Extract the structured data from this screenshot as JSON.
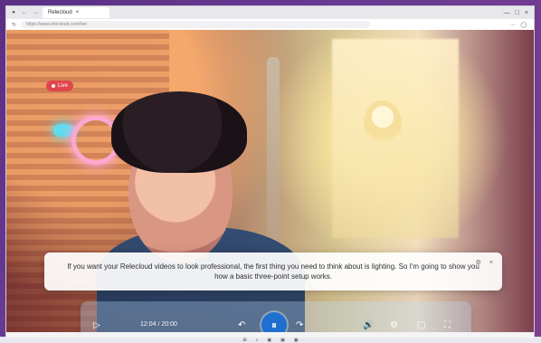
{
  "browser": {
    "tab_title": "Relecloud",
    "url": "https://www.relecloud.com/live",
    "window_controls": {
      "minimize": "—",
      "maximize": "□",
      "close": "×"
    }
  },
  "video": {
    "live_label": "Live",
    "caption": "If you want your Relecloud videos to look professional, the first thing you need to think about is lighting. So I'm going to show you how a basic three-point setup works.",
    "time": "12:04 / 20:00",
    "progress": 0.6
  },
  "icons": {
    "back": "←",
    "forward": "→",
    "refresh": "↻",
    "play": "▷",
    "rewind": "↶",
    "pause": "⏸",
    "forward10": "↷",
    "volume": "🔊",
    "settings": "⚙",
    "cc": "▢",
    "fullscreen": "⛶",
    "caption_settings": "⚙",
    "caption_close": "×"
  }
}
